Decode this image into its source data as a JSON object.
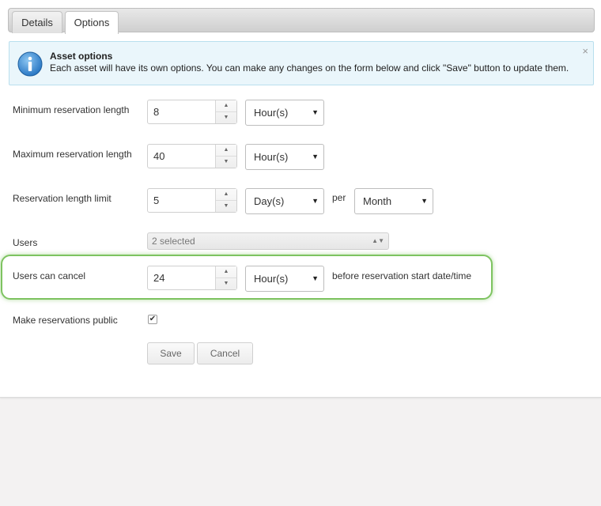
{
  "tabs": {
    "details": "Details",
    "options": "Options"
  },
  "info": {
    "title": "Asset options",
    "text": "Each asset will have its own options. You can make any changes on the form below and click \"Save\" button to update them.",
    "close": "×"
  },
  "form": {
    "min_length": {
      "label": "Minimum reservation length",
      "value": "8",
      "unit": "Hour(s)"
    },
    "max_length": {
      "label": "Maximum reservation length",
      "value": "40",
      "unit": "Hour(s)"
    },
    "length_limit": {
      "label": "Reservation length limit",
      "value": "5",
      "unit": "Day(s)",
      "per": "per",
      "period": "Month"
    },
    "users": {
      "label": "Users",
      "selected": "2 selected"
    },
    "cancel": {
      "label": "Users can cancel",
      "value": "24",
      "unit": "Hour(s)",
      "suffix": "before reservation start date/time"
    },
    "public": {
      "label": "Make reservations public",
      "checked": true
    }
  },
  "buttons": {
    "save": "Save",
    "cancel": "Cancel"
  },
  "colors": {
    "highlight": "#7dc360",
    "info_bg": "#eaf6fb",
    "info_icon": "#3a8fd6"
  }
}
